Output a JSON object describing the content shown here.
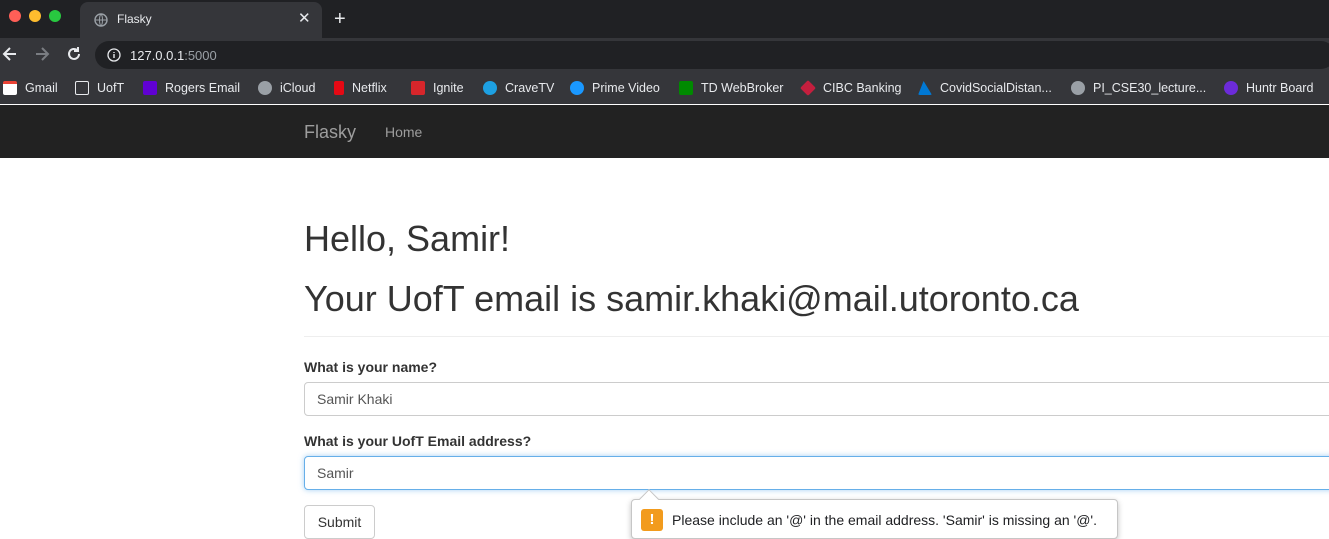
{
  "browser": {
    "tab_title": "Flasky",
    "tab_close": "✕",
    "new_tab": "+",
    "url_host": "127.0.0.1",
    "url_port": ":5000",
    "bookmarks": [
      {
        "label": "Gmail",
        "icon": "gmail-icon"
      },
      {
        "label": "UofT",
        "icon": "folder-icon"
      },
      {
        "label": "Rogers Email",
        "icon": "rogers-mail-icon"
      },
      {
        "label": "iCloud",
        "icon": "apple-icon"
      },
      {
        "label": "Netflix",
        "icon": "netflix-icon"
      },
      {
        "label": "Ignite",
        "icon": "ignite-icon"
      },
      {
        "label": "CraveTV",
        "icon": "crave-icon"
      },
      {
        "label": "Prime Video",
        "icon": "prime-video-icon"
      },
      {
        "label": "TD WebBroker",
        "icon": "td-icon"
      },
      {
        "label": "CIBC Banking",
        "icon": "cibc-icon"
      },
      {
        "label": "CovidSocialDistan...",
        "icon": "azure-icon"
      },
      {
        "label": "PI_CSE30_lecture...",
        "icon": "globe-icon"
      },
      {
        "label": "Huntr Board",
        "icon": "huntr-icon"
      }
    ]
  },
  "navbar": {
    "brand": "Flasky",
    "home": "Home"
  },
  "page": {
    "greeting": "Hello, Samir!",
    "email_line": "Your UofT email is samir.khaki@mail.utoronto.ca",
    "name_label": "What is your name?",
    "name_value": "Samir Khaki",
    "email_label": "What is your UofT Email address?",
    "email_value": "Samir",
    "submit_label": "Submit"
  },
  "validation": {
    "icon": "!",
    "message": "Please include an '@' in the email address. 'Samir' is missing an '@'."
  },
  "colors": {
    "navbar_bg": "#222222",
    "focus_border": "#66afe9",
    "warning": "#f29b1d"
  }
}
